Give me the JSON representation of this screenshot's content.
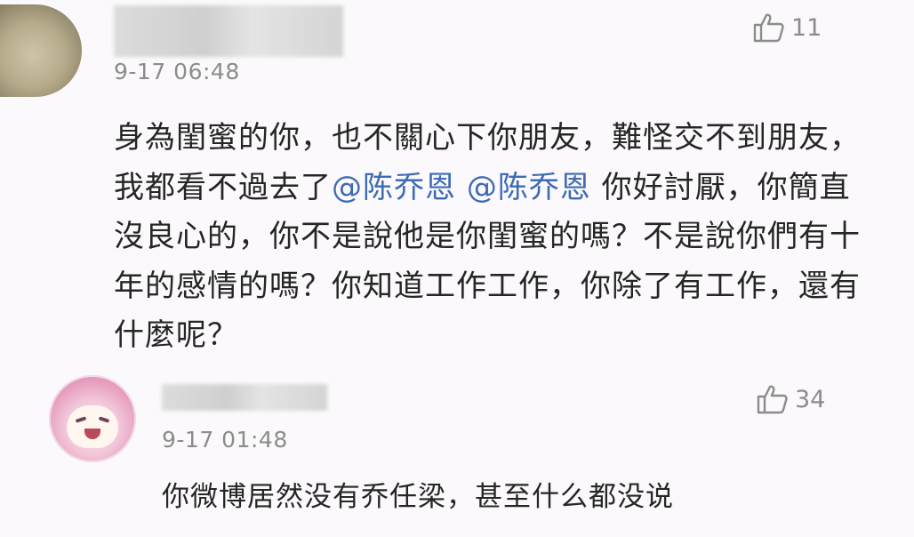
{
  "comments": [
    {
      "timestamp": "9-17 06:48",
      "likes": "11",
      "text_part1": "身為閨蜜的你，也不關心下你朋友，難怪交不到朋友，我都看不過去了",
      "mention1": "@陈乔恩",
      "mention2": "@陈乔恩",
      "text_part2": " 你好討厭，你簡直沒良心的，你不是說他是你閨蜜的嗎？不是說你們有十年的感情的嗎？你知道工作工作，你除了有工作，還有什麼呢？"
    },
    {
      "timestamp": "9-17 01:48",
      "likes": "34",
      "text": "你微博居然没有乔任梁，甚至什么都没说"
    }
  ],
  "icons": {
    "like": "thumbs-up-icon",
    "avatar1": "avatar",
    "avatar2": "avatar"
  },
  "colors": {
    "background": "#fbf9fb",
    "text": "#262626",
    "meta": "#8c8c8c",
    "mention": "#3d6bb4"
  }
}
